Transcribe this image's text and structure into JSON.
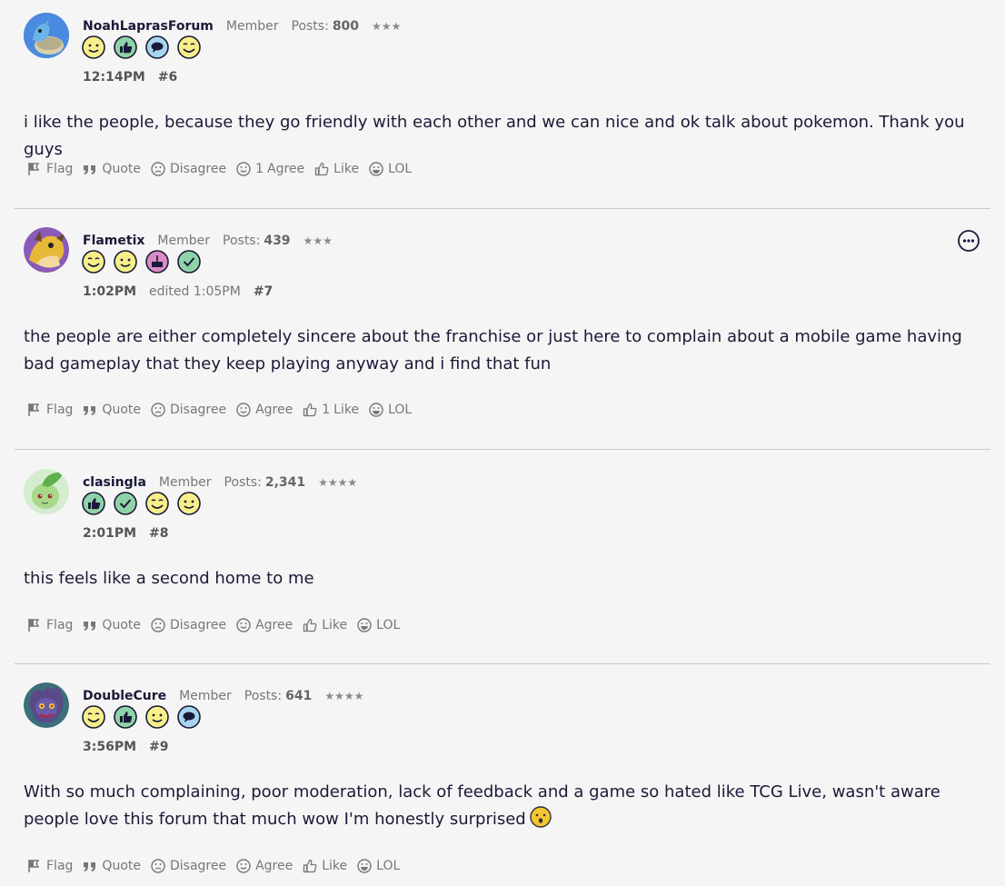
{
  "posts": [
    {
      "username": "NoahLaprasForum",
      "rank": "Member",
      "posts_label": "Posts:",
      "posts_count": "800",
      "stars": "★★★",
      "badges": [
        "happy-face",
        "thumbs-up",
        "speech-bubble",
        "wink-face"
      ],
      "time": "12:14PM",
      "edited": "",
      "number": "#6",
      "body": "i like the people, because they go friendly with each other and we can nice and ok talk about pokemon. Thank you guys",
      "actions": {
        "flag": "Flag",
        "quote": "Quote",
        "disagree": "Disagree",
        "agree_count": "1",
        "agree": "Agree",
        "like_count": "",
        "like": "Like",
        "lol": "LOL"
      }
    },
    {
      "username": "Flametix",
      "rank": "Member",
      "posts_label": "Posts:",
      "posts_count": "439",
      "stars": "★★★",
      "badges": [
        "wink-face",
        "happy-face",
        "cake",
        "check-mark"
      ],
      "time": "1:02PM",
      "edited": "edited 1:05PM",
      "number": "#7",
      "body": "the people are either completely sincere about the franchise or just here to complain about a mobile game having bad gameplay that they keep playing anyway and i find that fun",
      "actions": {
        "flag": "Flag",
        "quote": "Quote",
        "disagree": "Disagree",
        "agree_count": "",
        "agree": "Agree",
        "like_count": "1",
        "like": "Like",
        "lol": "LOL"
      }
    },
    {
      "username": "clasingla",
      "rank": "Member",
      "posts_label": "Posts:",
      "posts_count": "2,341",
      "stars": "★★★★",
      "badges": [
        "thumbs-up",
        "check-mark",
        "wink-face",
        "happy-face"
      ],
      "time": "2:01PM",
      "edited": "",
      "number": "#8",
      "body": "this feels like a second home to me",
      "actions": {
        "flag": "Flag",
        "quote": "Quote",
        "disagree": "Disagree",
        "agree_count": "",
        "agree": "Agree",
        "like_count": "",
        "like": "Like",
        "lol": "LOL"
      }
    },
    {
      "username": "DoubleCure",
      "rank": "Member",
      "posts_label": "Posts:",
      "posts_count": "641",
      "stars": "★★★★",
      "badges": [
        "wink-face",
        "thumbs-up",
        "happy-face",
        "speech-bubble"
      ],
      "time": "3:56PM",
      "edited": "",
      "number": "#9",
      "body": "With so much complaining, poor moderation, lack of feedback and a game so hated like TCG Live, wasn't aware people love this forum that much wow I'm honestly surprised",
      "body_emoji": "surprised-face",
      "actions": {
        "flag": "Flag",
        "quote": "Quote",
        "disagree": "Disagree",
        "agree_count": "",
        "agree": "Agree",
        "like_count": "",
        "like": "Like",
        "lol": "LOL"
      }
    }
  ],
  "colors": {
    "background": "#f5f5f5",
    "text": "#1a1a38",
    "muted": "#777777",
    "divider": "#c9c9c9",
    "badge_yellow": "#f7ef8a",
    "badge_green": "#8fd3a8",
    "badge_blue": "#a8d4f0",
    "badge_pink": "#d98cc4"
  }
}
